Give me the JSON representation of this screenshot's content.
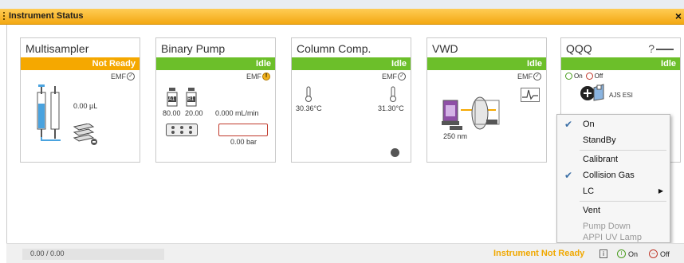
{
  "window": {
    "title": "Instrument Status",
    "close_glyph": "×"
  },
  "modules": {
    "multisampler": {
      "name": "Multisampler",
      "status": "Not Ready",
      "emf": "EMF",
      "volume": "0.00 µL"
    },
    "binary_pump": {
      "name": "Binary Pump",
      "status": "Idle",
      "emf": "EMF",
      "solvent_a_label": "A1",
      "solvent_b_label": "B1",
      "solvent_a_pct": "80.00",
      "solvent_b_pct": "20.00",
      "flow": "0.000 mL/min",
      "pressure": "0.00 bar"
    },
    "column_comp": {
      "name": "Column Comp.",
      "status": "Idle",
      "emf": "EMF",
      "temp_left": "30.36°C",
      "temp_right": "31.30°C"
    },
    "vwd": {
      "name": "VWD",
      "status": "Idle",
      "emf": "EMF",
      "wavelength": "250 nm"
    },
    "qqq": {
      "name": "QQQ",
      "status": "Idle",
      "help": "?",
      "on_label": "On",
      "off_label": "Off",
      "source": "AJS ESI"
    }
  },
  "context_menu": {
    "items": [
      {
        "label": "On",
        "checked": true,
        "disabled": false
      },
      {
        "label": "StandBy",
        "checked": false,
        "disabled": false
      },
      {
        "label": "Calibrant",
        "checked": false,
        "disabled": false
      },
      {
        "label": "Collision Gas",
        "checked": true,
        "disabled": false
      },
      {
        "label": "LC",
        "checked": false,
        "disabled": false,
        "submenu": true
      },
      {
        "label": "Vent",
        "checked": false,
        "disabled": false
      },
      {
        "label": "Pump Down",
        "checked": false,
        "disabled": true
      },
      {
        "label": "APPI UV Lamp",
        "checked": false,
        "disabled": true
      }
    ],
    "check_glyph": "✔",
    "arrow_glyph": "▶"
  },
  "footer": {
    "progress_text": "0.00 / 0.00",
    "status_prefix": "Instrument",
    "status_value": "Not Ready",
    "on_label": "On",
    "off_label": "Off"
  },
  "colors": {
    "accent": "#f3a813",
    "idle": "#6cbf2a",
    "not_ready": "#f5a800"
  },
  "icons": [
    "syringe-icon",
    "vial-rack-icon",
    "solvent-bottle-icon",
    "thermometer-icon",
    "detector-lamp-icon",
    "signal-icon",
    "ion-source-icon"
  ]
}
